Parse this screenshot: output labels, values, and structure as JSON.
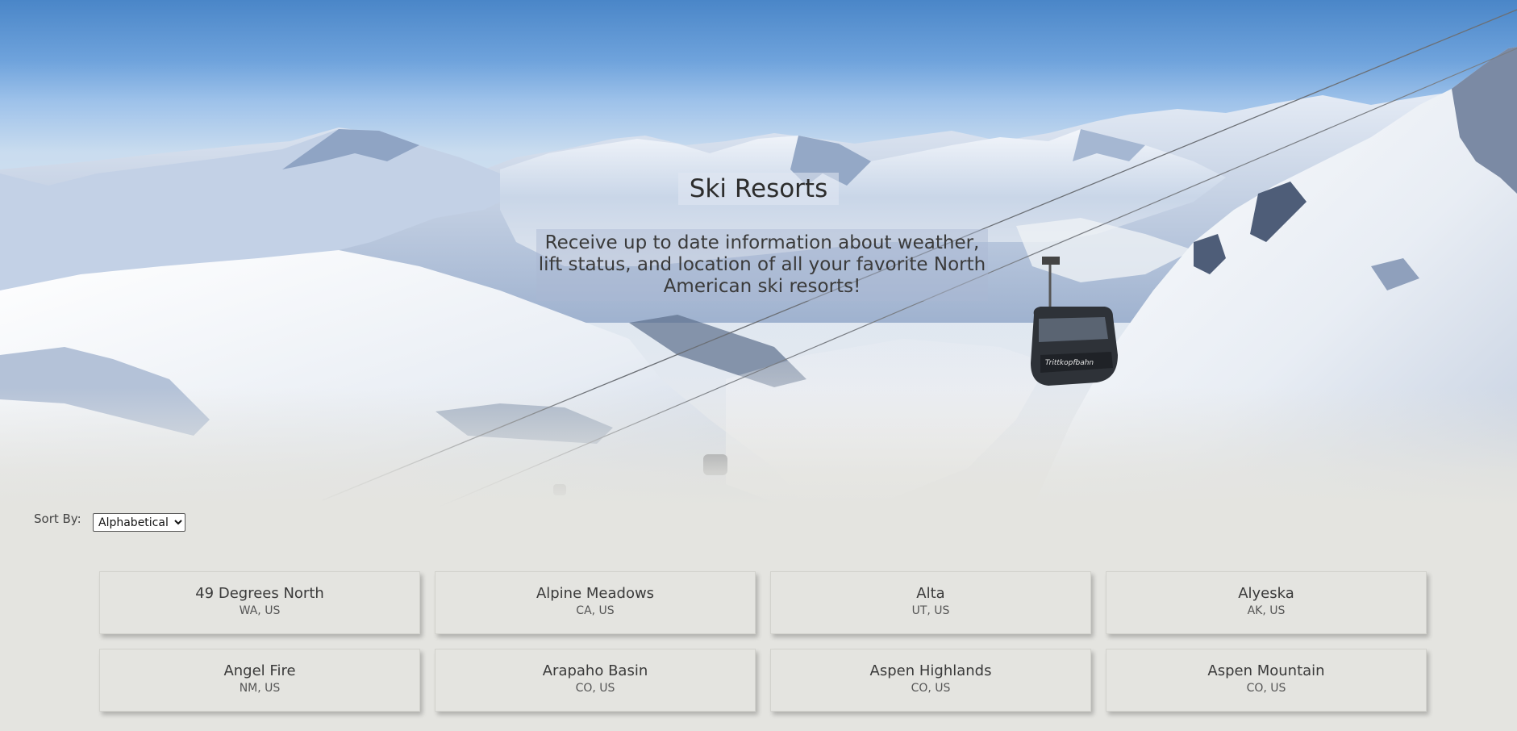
{
  "hero": {
    "title": "Ski Resorts",
    "description": "Receive up to date information about weather, lift status, and location of all your favorite North American ski resorts!",
    "gondola_text": "Trittkopfbahn"
  },
  "sort": {
    "label": "Sort By:",
    "selected": "Alphabetical"
  },
  "resorts": [
    {
      "name": "49 Degrees North",
      "location": "WA, US"
    },
    {
      "name": "Alpine Meadows",
      "location": "CA, US"
    },
    {
      "name": "Alta",
      "location": "UT, US"
    },
    {
      "name": "Alyeska",
      "location": "AK, US"
    },
    {
      "name": "Angel Fire",
      "location": "NM, US"
    },
    {
      "name": "Arapaho Basin",
      "location": "CO, US"
    },
    {
      "name": "Aspen Highlands",
      "location": "CO, US"
    },
    {
      "name": "Aspen Mountain",
      "location": "CO, US"
    }
  ]
}
